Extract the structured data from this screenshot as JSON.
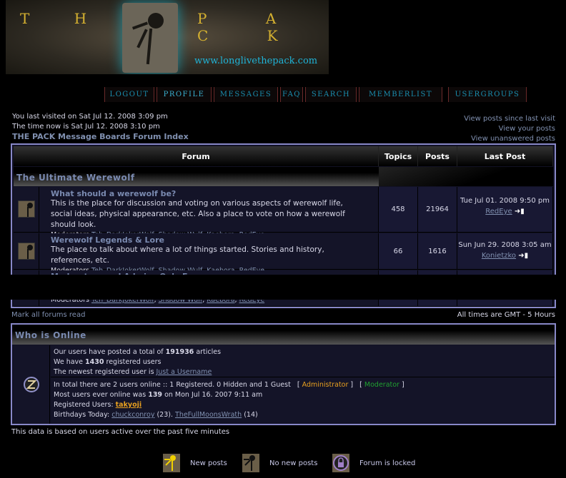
{
  "banner": {
    "title_left": "T H E",
    "title_right": "P A C K",
    "url": "www.longlivethepack.com"
  },
  "nav": [
    {
      "label": "LOGOUT"
    },
    {
      "label": "PROFILE"
    },
    {
      "label": "MESSAGES"
    },
    {
      "label": "FAQ"
    },
    {
      "label": "SEARCH"
    },
    {
      "label": "MEMBERLIST"
    },
    {
      "label": "USERGROUPS"
    }
  ],
  "info": {
    "last_visit": "You last visited on Sat Jul 12. 2008 3:09 pm",
    "time_now": "The time now is Sat Jul 12. 2008 3:10 pm",
    "index_link": "THE PACK Message Boards Forum Index"
  },
  "quick_links": [
    "View posts since last visit",
    "View your posts",
    "View unanswered posts"
  ],
  "table": {
    "headers": [
      "Forum",
      "Topics",
      "Posts",
      "Last Post"
    ],
    "category": "The Ultimate Werewolf",
    "forums": [
      {
        "title": "What should a werewolf be?",
        "desc": "This is the place for discussion and voting on various aspects of werewolf life, social ideas, physical appearance, etc. Also a place to vote on how a werewolf should look.",
        "mods_label": "Moderators",
        "mods": [
          "Teh_DarkJokerWolf",
          "Shadow Wulf",
          "Kaebora",
          "RedEye"
        ],
        "topics": "458",
        "posts": "21964",
        "last_date": "Tue Jul 01. 2008 9:50 pm",
        "last_user": "RedEye"
      },
      {
        "title": "Werewolf Legends & Lore",
        "desc": "The place to talk about where a lot of things started. Stories and history, references, etc.",
        "mods_label": "Moderators",
        "mods": [
          "Teh_DarkJokerWolf",
          "Shadow Wulf",
          "Kaebora",
          "RedEye"
        ],
        "topics": "66",
        "posts": "1616",
        "last_date": "Sun Jun 29. 2008 3:05 am",
        "last_user": "Konietzko"
      },
      {
        "title": "Moderators and Admins Only Forum",
        "mods_label": "Moderators",
        "mods": [
          "Teh_DarkJokerWolf",
          "Shadow Wulf",
          "Kaebora",
          "RedEye"
        ]
      }
    ]
  },
  "mark_read": "Mark all forums read",
  "timezone": "All times are GMT - 5 Hours",
  "who": {
    "title": "Who is Online",
    "l1a": "Our users have posted a total of ",
    "l1b": "191936",
    "l1c": " articles",
    "l2a": "We have ",
    "l2b": "1430",
    "l2c": " registered users",
    "l3a": "The newest registered user is ",
    "l3b": "Just a Username",
    "l4": "In total there are 2 users online :: 1 Registered. 0 Hidden and 1 Guest",
    "admin": "Administrator",
    "moderator": "Moderator",
    "l5a": "Most users ever online was ",
    "l5b": "139",
    "l5c": " on Mon Jul 16. 2007 9:11 am",
    "l6a": "Registered Users: ",
    "l6b": "takyoji",
    "l7a": "Birthdays Today: ",
    "b1": "chuckconroy",
    "b1age": " (23). ",
    "b2": "TheFullMoonsWrath",
    "b2age": " (14)"
  },
  "footer_note": "This data is based on users active over the past five minutes",
  "legend": [
    "New posts",
    "No new posts",
    "Forum is locked"
  ],
  "colors": {
    "accent": "#8888c8",
    "nav": "#1a8fb0",
    "admin": "#e8a020",
    "moderator": "#20a030"
  }
}
